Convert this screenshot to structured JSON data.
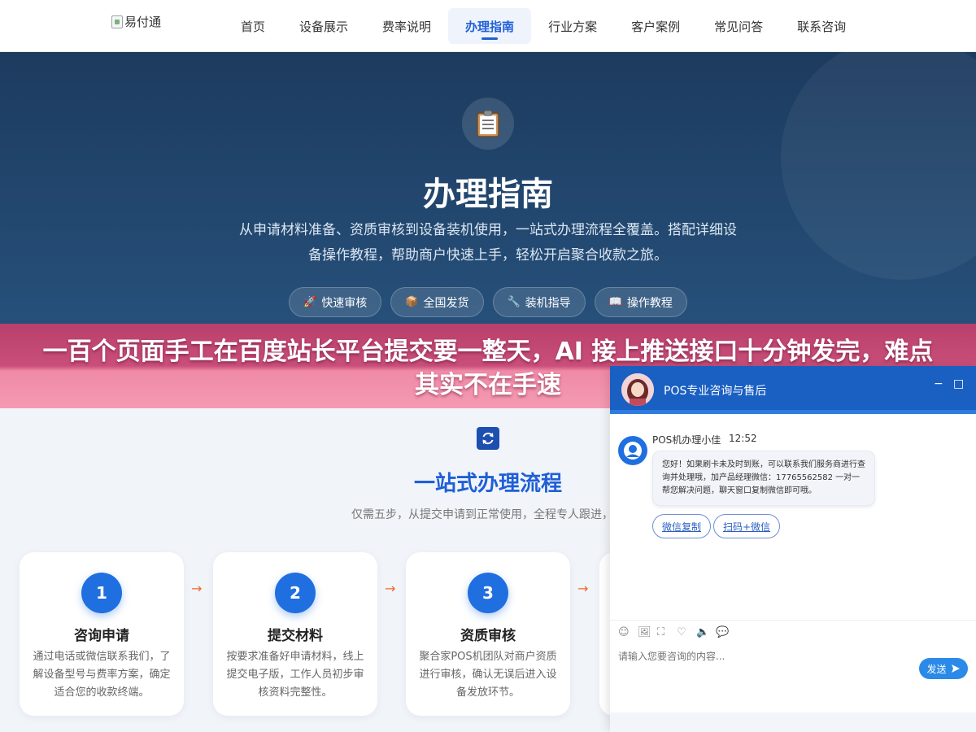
{
  "nav": {
    "logo_alt": "易付通",
    "items": [
      "首页",
      "设备展示",
      "费率说明",
      "办理指南",
      "行业方案",
      "客户案例",
      "常见问答",
      "联系咨询"
    ],
    "active_index": 3
  },
  "hero": {
    "icon": "clipboard-icon",
    "title": "办理指南",
    "description": "从申请材料准备、资质审核到设备装机使用，一站式办理流程全覆盖。搭配详细设备操作教程，帮助商户快速上手，轻松开启聚合收款之旅。",
    "pills": [
      {
        "icon": "🚀",
        "label": "快速审核"
      },
      {
        "icon": "📦",
        "label": "全国发货"
      },
      {
        "icon": "🔧",
        "label": "装机指导"
      },
      {
        "icon": "📖",
        "label": "操作教程"
      }
    ]
  },
  "banner": {
    "text": "一百个页面手工在百度站长平台提交要一整天，AI 接上推送接口十分钟发完，难点其实不在手速"
  },
  "process": {
    "icon": "refresh-icon",
    "title": "一站式办理流程",
    "description": "仅需五步，从提交申请到正常使用，全程专人跟进，高",
    "steps": [
      {
        "num": "1",
        "title": "咨询申请",
        "desc": "通过电话或微信联系我们，了解设备型号与费率方案，确定适合您的收款终端。"
      },
      {
        "num": "2",
        "title": "提交材料",
        "desc": "按要求准备好申请材料，线上提交电子版，工作人员初步审核资料完整性。"
      },
      {
        "num": "3",
        "title": "资质审核",
        "desc": "聚合家POS机团队对商户资质进行审核，确认无误后进入设备发放环节。"
      }
    ],
    "arrow": "→"
  },
  "chat": {
    "header_title": "POS专业咨询与售后",
    "minimize": "−",
    "maximize": "□",
    "agent_name": "POS机办理小佳",
    "time": "12:52",
    "message": "您好！如果刷卡未及时到账，可以联系我们服务商进行查询并处理哦，加产品经理微信：17765562582 一对一帮您解决问题，聊天窗口复制微信即可哦。",
    "quick_buttons": [
      "微信复制",
      "扫码+微信"
    ],
    "tools": [
      "☺",
      "🖼",
      "⛶",
      "♡",
      "🔈",
      "💬"
    ],
    "input_placeholder": "请输入您要咨询的内容...",
    "send_label": "发送"
  },
  "colors": {
    "accent": "#1f5fd6",
    "hero_bg": "#1d3b5f",
    "banner": "#c94f7a",
    "arrow": "#f06a2c"
  }
}
